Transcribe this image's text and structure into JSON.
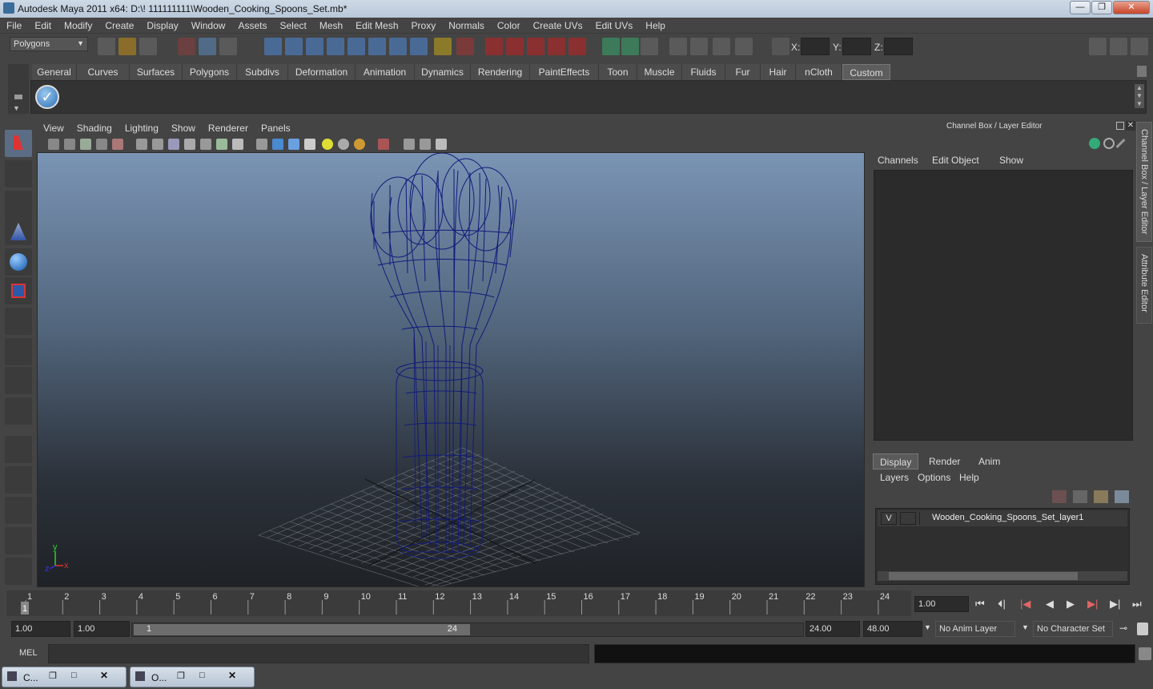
{
  "window": {
    "title": "Autodesk Maya 2011 x64: D:\\! 111111111\\Wooden_Cooking_Spoons_Set.mb*",
    "min": "—",
    "restore": "❐",
    "close": "✕"
  },
  "menu": [
    "File",
    "Edit",
    "Modify",
    "Create",
    "Display",
    "Window",
    "Assets",
    "Select",
    "Mesh",
    "Edit Mesh",
    "Proxy",
    "Normals",
    "Color",
    "Create UVs",
    "Edit UVs",
    "Help"
  ],
  "status": {
    "menuset": "Polygons",
    "x_label": "X:",
    "y_label": "Y:",
    "z_label": "Z:"
  },
  "shelf_tabs": [
    "General",
    "Curves",
    "Surfaces",
    "Polygons",
    "Subdivs",
    "Deformation",
    "Animation",
    "Dynamics",
    "Rendering",
    "PaintEffects",
    "Toon",
    "Muscle",
    "Fluids",
    "Fur",
    "Hair",
    "nCloth",
    "Custom"
  ],
  "shelf_active": "Custom",
  "viewport": {
    "menu": [
      "View",
      "Shading",
      "Lighting",
      "Show",
      "Renderer",
      "Panels"
    ],
    "axis_x": "x",
    "axis_y": "y",
    "axis_z": "z"
  },
  "channelbox": {
    "title": "Channel Box / Layer Editor",
    "menu": [
      "Channels",
      "Edit",
      "Object",
      "Show"
    ],
    "side_tab1": "Channel Box / Layer Editor",
    "side_tab2": "Attribute Editor"
  },
  "layer_editor": {
    "tabs": [
      "Display",
      "Render",
      "Anim"
    ],
    "active": "Display",
    "menu": [
      "Layers",
      "Options",
      "Help"
    ],
    "layer": {
      "visible": "V",
      "name": "Wooden_Cooking_Spoons_Set_layer1"
    }
  },
  "timeline": {
    "ticks": [
      "1",
      "2",
      "3",
      "4",
      "5",
      "6",
      "7",
      "8",
      "9",
      "10",
      "11",
      "12",
      "13",
      "14",
      "15",
      "16",
      "17",
      "18",
      "19",
      "20",
      "21",
      "22",
      "23",
      "24"
    ],
    "current_frame": "1",
    "current_time": "1.00"
  },
  "range": {
    "start": "1.00",
    "anim_start": "1.00",
    "range_start": "1",
    "range_end": "24",
    "anim_end": "24.00",
    "end": "48.00",
    "anim_layer": "No Anim Layer",
    "char_set": "No Character Set"
  },
  "command": {
    "label": "MEL"
  },
  "taskbar": [
    {
      "label": "C..."
    },
    {
      "label": "O..."
    }
  ]
}
